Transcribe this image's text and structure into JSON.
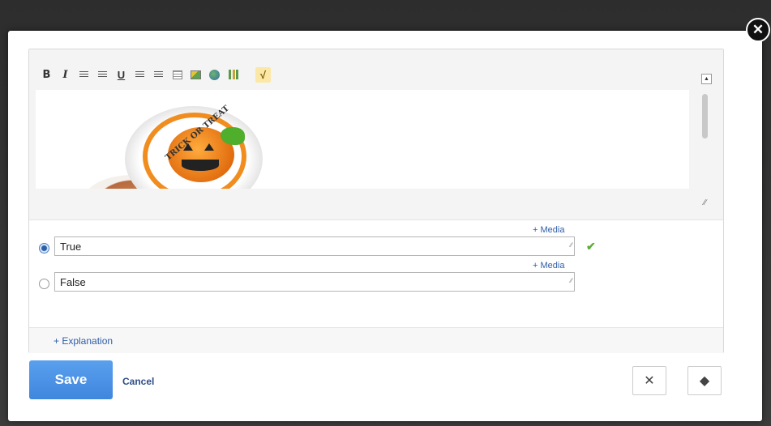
{
  "toolbar": {
    "buttons": [
      {
        "name": "bold-button",
        "icon": "bold-icon",
        "glyph": "B"
      },
      {
        "name": "italic-button",
        "icon": "italic-icon",
        "glyph": "I"
      },
      {
        "name": "ordered-list-button",
        "icon": "ordered-list-icon",
        "glyph": "☰"
      },
      {
        "name": "unordered-list-button",
        "icon": "unordered-list-icon",
        "glyph": "☰"
      },
      {
        "name": "underline-button",
        "icon": "underline-icon",
        "glyph": "U"
      },
      {
        "name": "align-left-button",
        "icon": "align-left-icon"
      },
      {
        "name": "align-right-button",
        "icon": "align-right-icon"
      },
      {
        "name": "table-button",
        "icon": "table-icon"
      },
      {
        "name": "image-button",
        "icon": "image-icon"
      },
      {
        "name": "link-button",
        "icon": "globe-icon"
      },
      {
        "name": "chart-button",
        "icon": "chart-icon"
      },
      {
        "name": "equation-button",
        "icon": "square-root-icon",
        "glyph": "√"
      }
    ]
  },
  "editor": {
    "image_text": "TRICK OR TREAT"
  },
  "answers": [
    {
      "label": "True",
      "selected": true,
      "media_label": "+ Media",
      "correct": true
    },
    {
      "label": "False",
      "selected": false,
      "media_label": "+ Media",
      "correct": false
    }
  ],
  "explanation_label": "+ Explanation",
  "actions": {
    "save_label": "Save",
    "cancel_label": "Cancel"
  },
  "icons": {
    "close": "close-icon",
    "correct": "check-icon",
    "tools": "tools-icon",
    "tag": "tag-icon"
  },
  "colors": {
    "accent": "#3f86de",
    "link": "#2f5ea8",
    "correct": "#5cae39"
  }
}
